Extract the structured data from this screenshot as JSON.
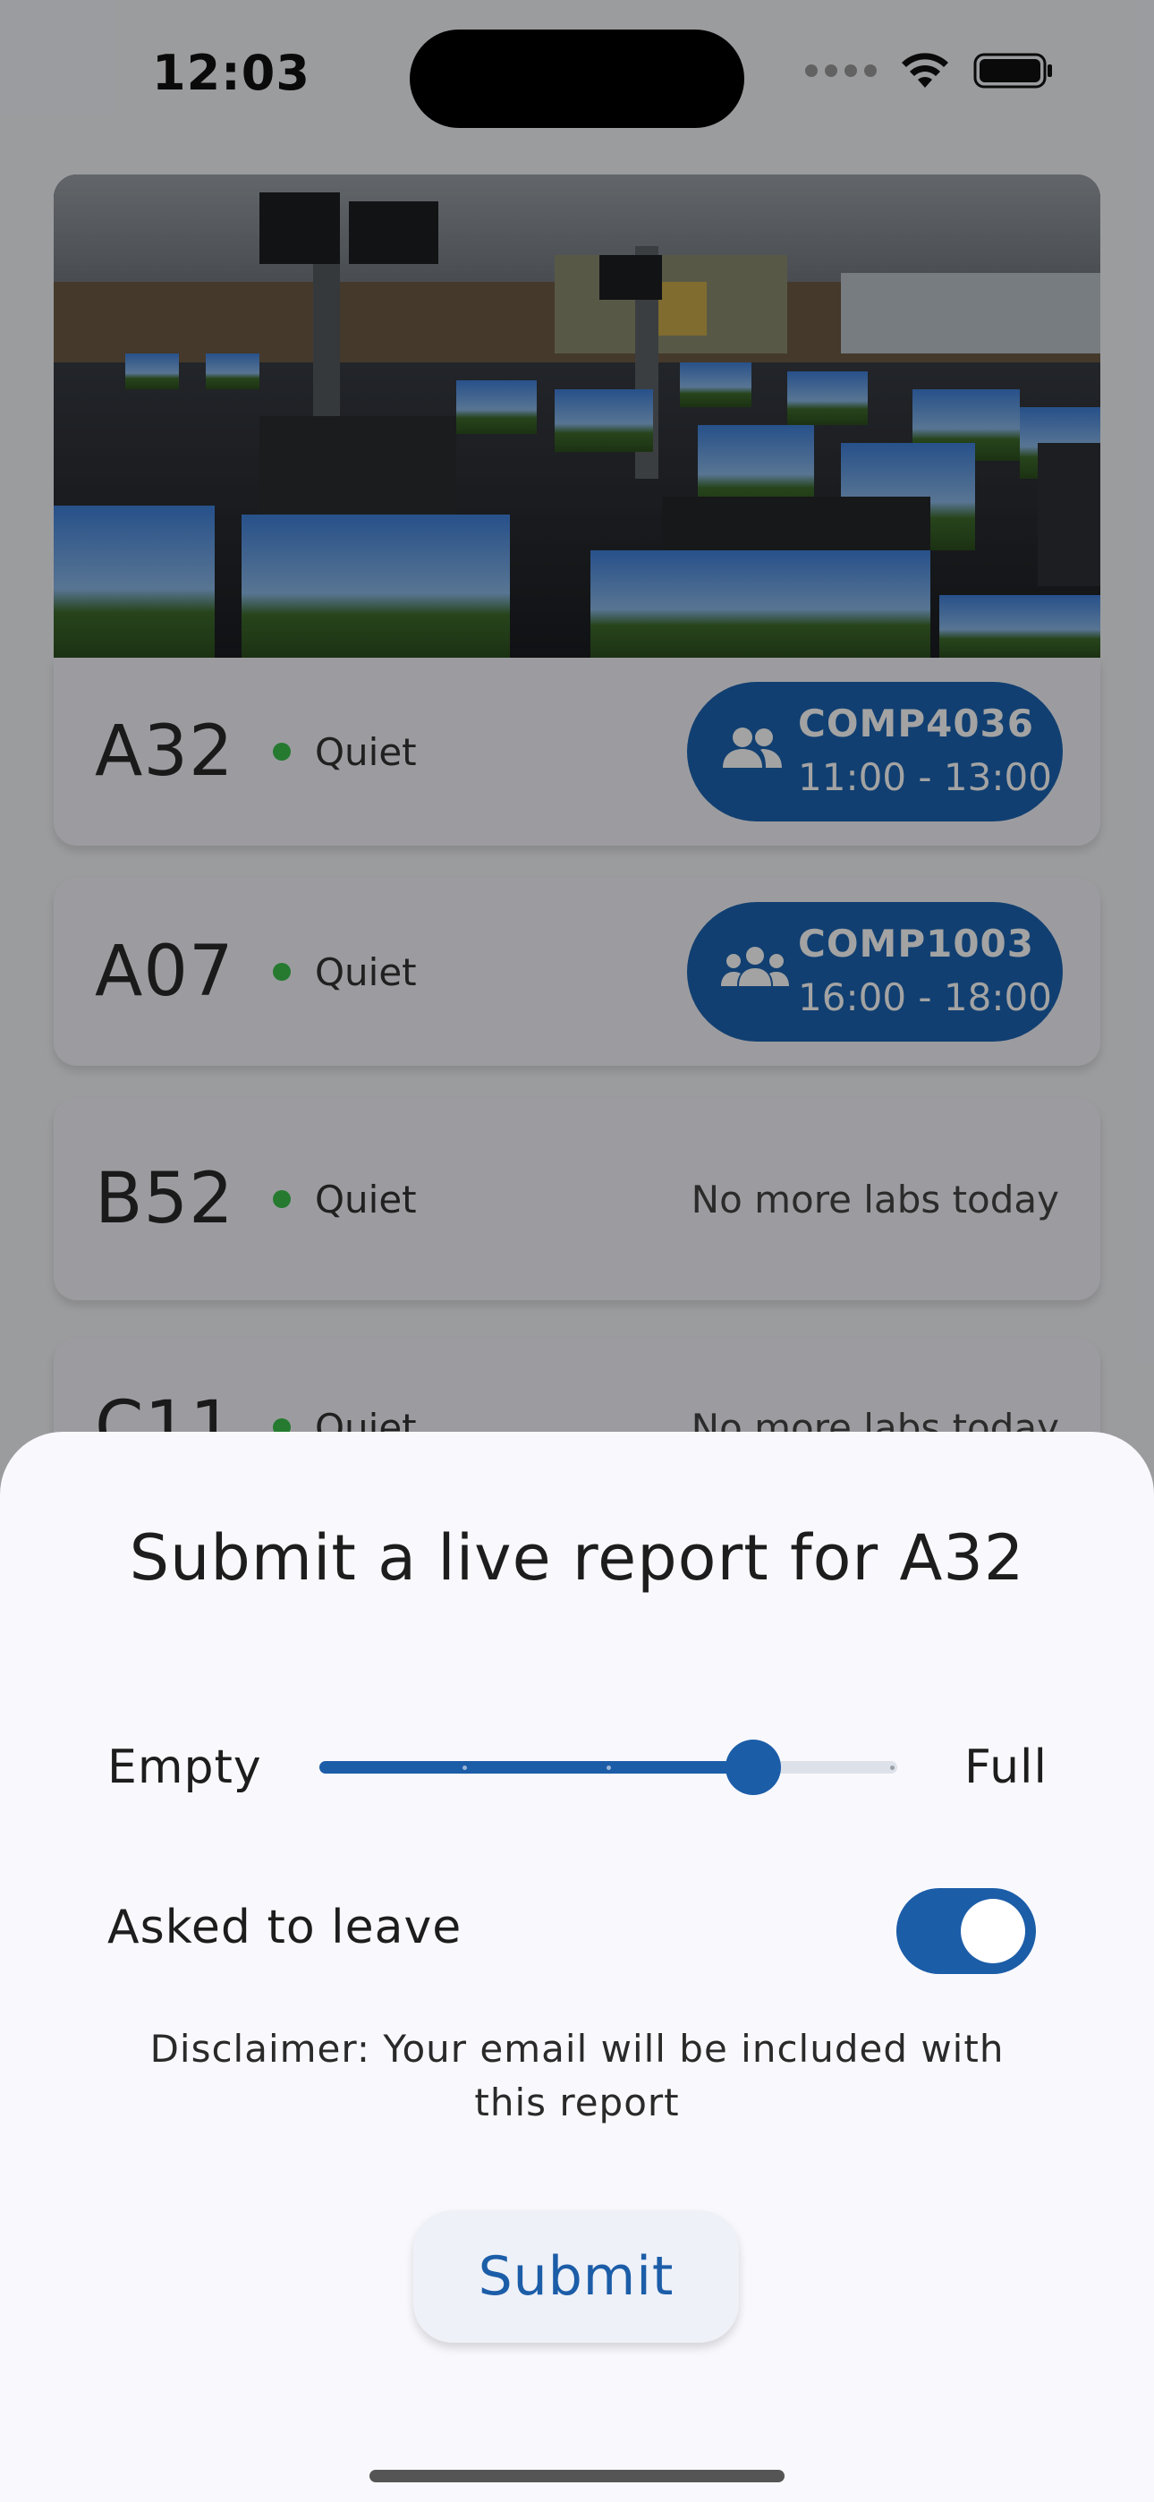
{
  "status_bar": {
    "time": "12:03"
  },
  "labs": [
    {
      "name": "A32",
      "status": "Quiet",
      "session": {
        "code": "COMP4036",
        "time": "11:00 - 13:00",
        "icon": "group-icon"
      }
    },
    {
      "name": "A07",
      "status": "Quiet",
      "session": {
        "code": "COMP1003",
        "time": "16:00 - 18:00",
        "icon": "groups-icon"
      }
    },
    {
      "name": "B52",
      "status": "Quiet",
      "note": "No more labs today"
    },
    {
      "name": "C11",
      "status": "Quiet",
      "note": "No more labs today"
    }
  ],
  "sheet": {
    "title": "Submit a live report for A32",
    "slider": {
      "left_label": "Empty",
      "right_label": "Full",
      "value": 0.75,
      "steps": 4
    },
    "toggle": {
      "label": "Asked to leave",
      "value": true
    },
    "disclaimer": "Disclaimer: Your email will be included with this report",
    "submit_label": "Submit"
  },
  "colors": {
    "accent": "#1c5da8",
    "status_quiet": "#3bbf4c",
    "pill_bg": "#1c63b1"
  }
}
